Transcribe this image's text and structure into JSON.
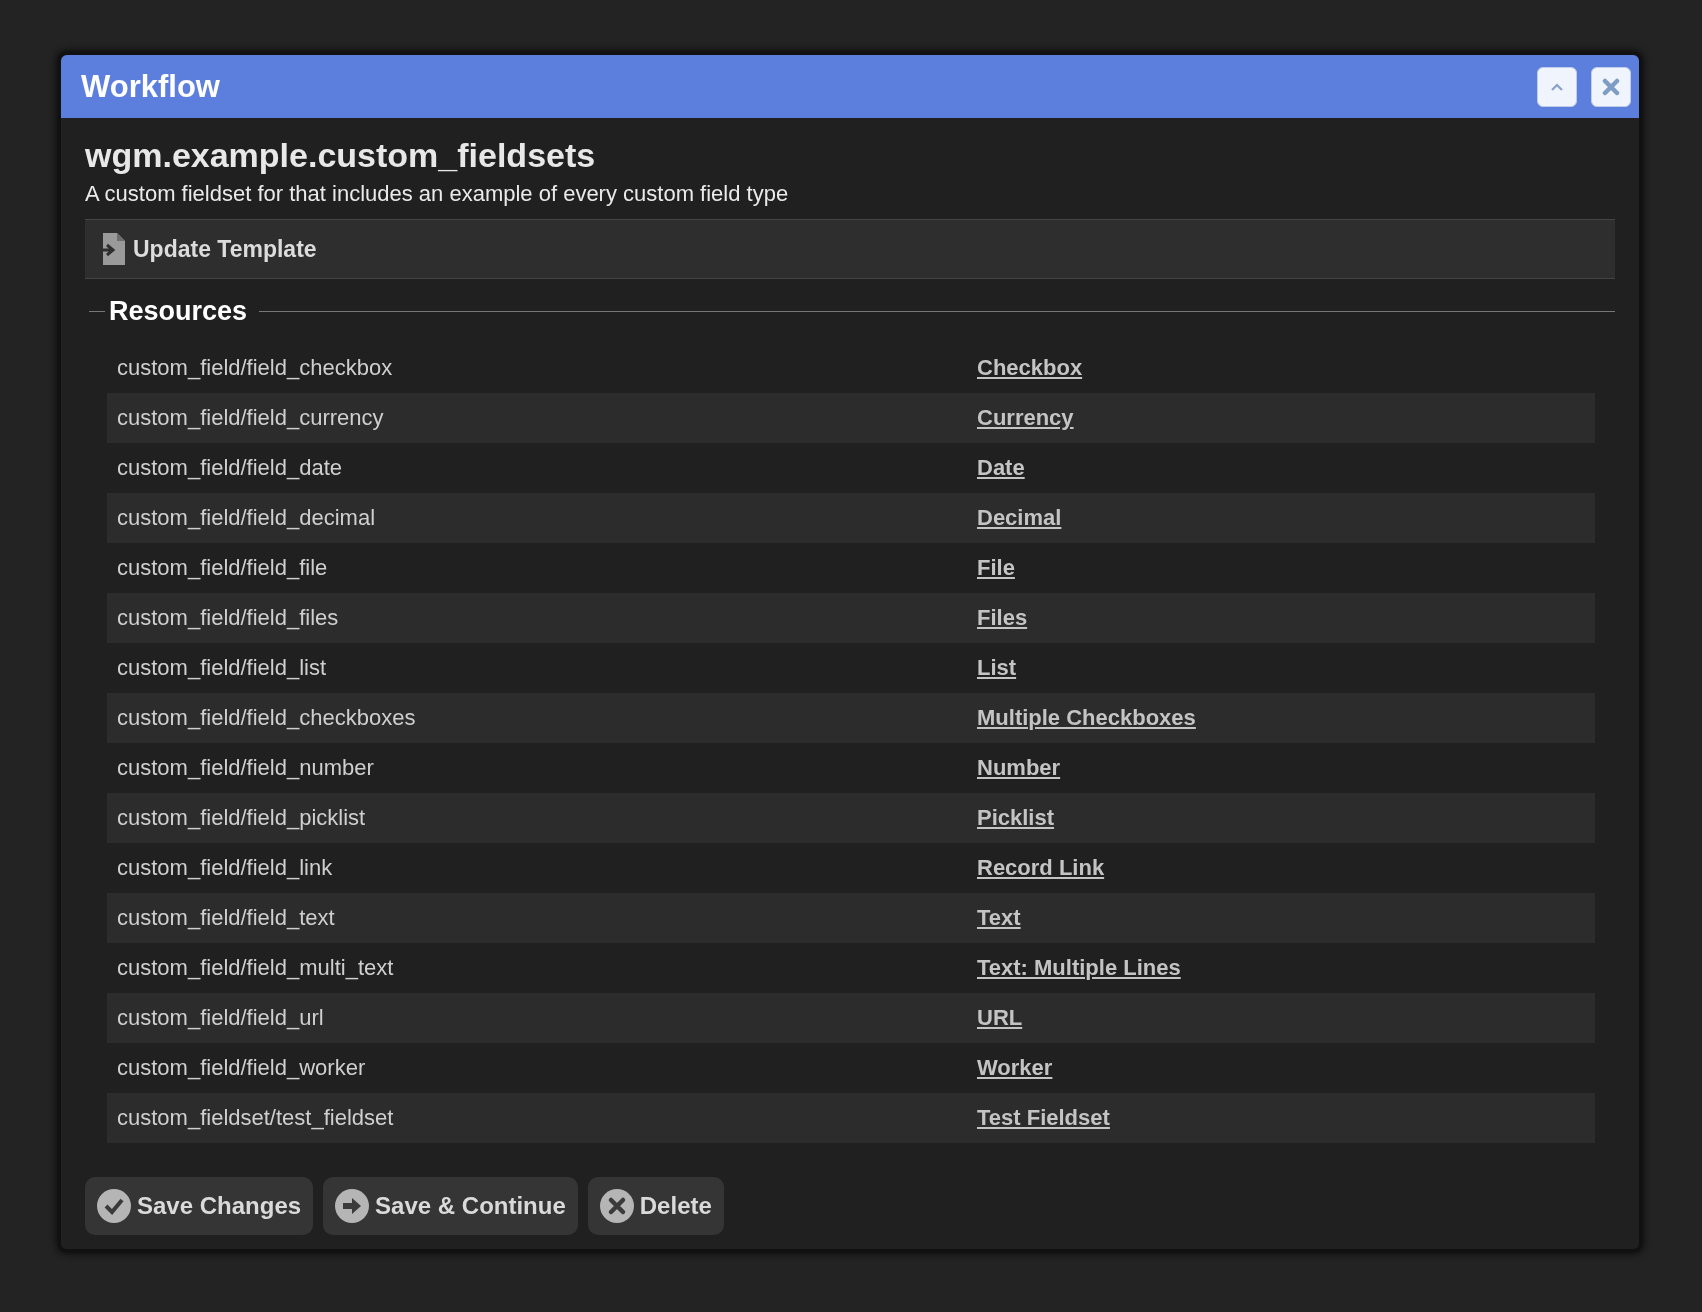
{
  "window": {
    "title": "Workflow"
  },
  "heading": "wgm.example.custom_fieldsets",
  "description": "A custom fieldset for that includes an example of every custom field type",
  "toolbar": {
    "button": "Update Template"
  },
  "resources": {
    "legend": "Resources",
    "rows": [
      {
        "path": "custom_field/field_checkbox",
        "link": "Checkbox"
      },
      {
        "path": "custom_field/field_currency",
        "link": "Currency"
      },
      {
        "path": "custom_field/field_date",
        "link": "Date"
      },
      {
        "path": "custom_field/field_decimal",
        "link": "Decimal"
      },
      {
        "path": "custom_field/field_file",
        "link": "File"
      },
      {
        "path": "custom_field/field_files",
        "link": "Files"
      },
      {
        "path": "custom_field/field_list",
        "link": "List"
      },
      {
        "path": "custom_field/field_checkboxes",
        "link": "Multiple Checkboxes"
      },
      {
        "path": "custom_field/field_number",
        "link": "Number"
      },
      {
        "path": "custom_field/field_picklist",
        "link": "Picklist"
      },
      {
        "path": "custom_field/field_link",
        "link": "Record Link"
      },
      {
        "path": "custom_field/field_text",
        "link": "Text"
      },
      {
        "path": "custom_field/field_multi_text",
        "link": "Text: Multiple Lines"
      },
      {
        "path": "custom_field/field_url",
        "link": "URL"
      },
      {
        "path": "custom_field/field_worker",
        "link": "Worker"
      },
      {
        "path": "custom_fieldset/test_fieldset",
        "link": "Test Fieldset"
      }
    ]
  },
  "buttons": [
    {
      "label": "Save Changes",
      "kind": "check"
    },
    {
      "label": "Save & Continue",
      "kind": "arrow"
    },
    {
      "label": "Delete",
      "kind": "cross"
    }
  ]
}
